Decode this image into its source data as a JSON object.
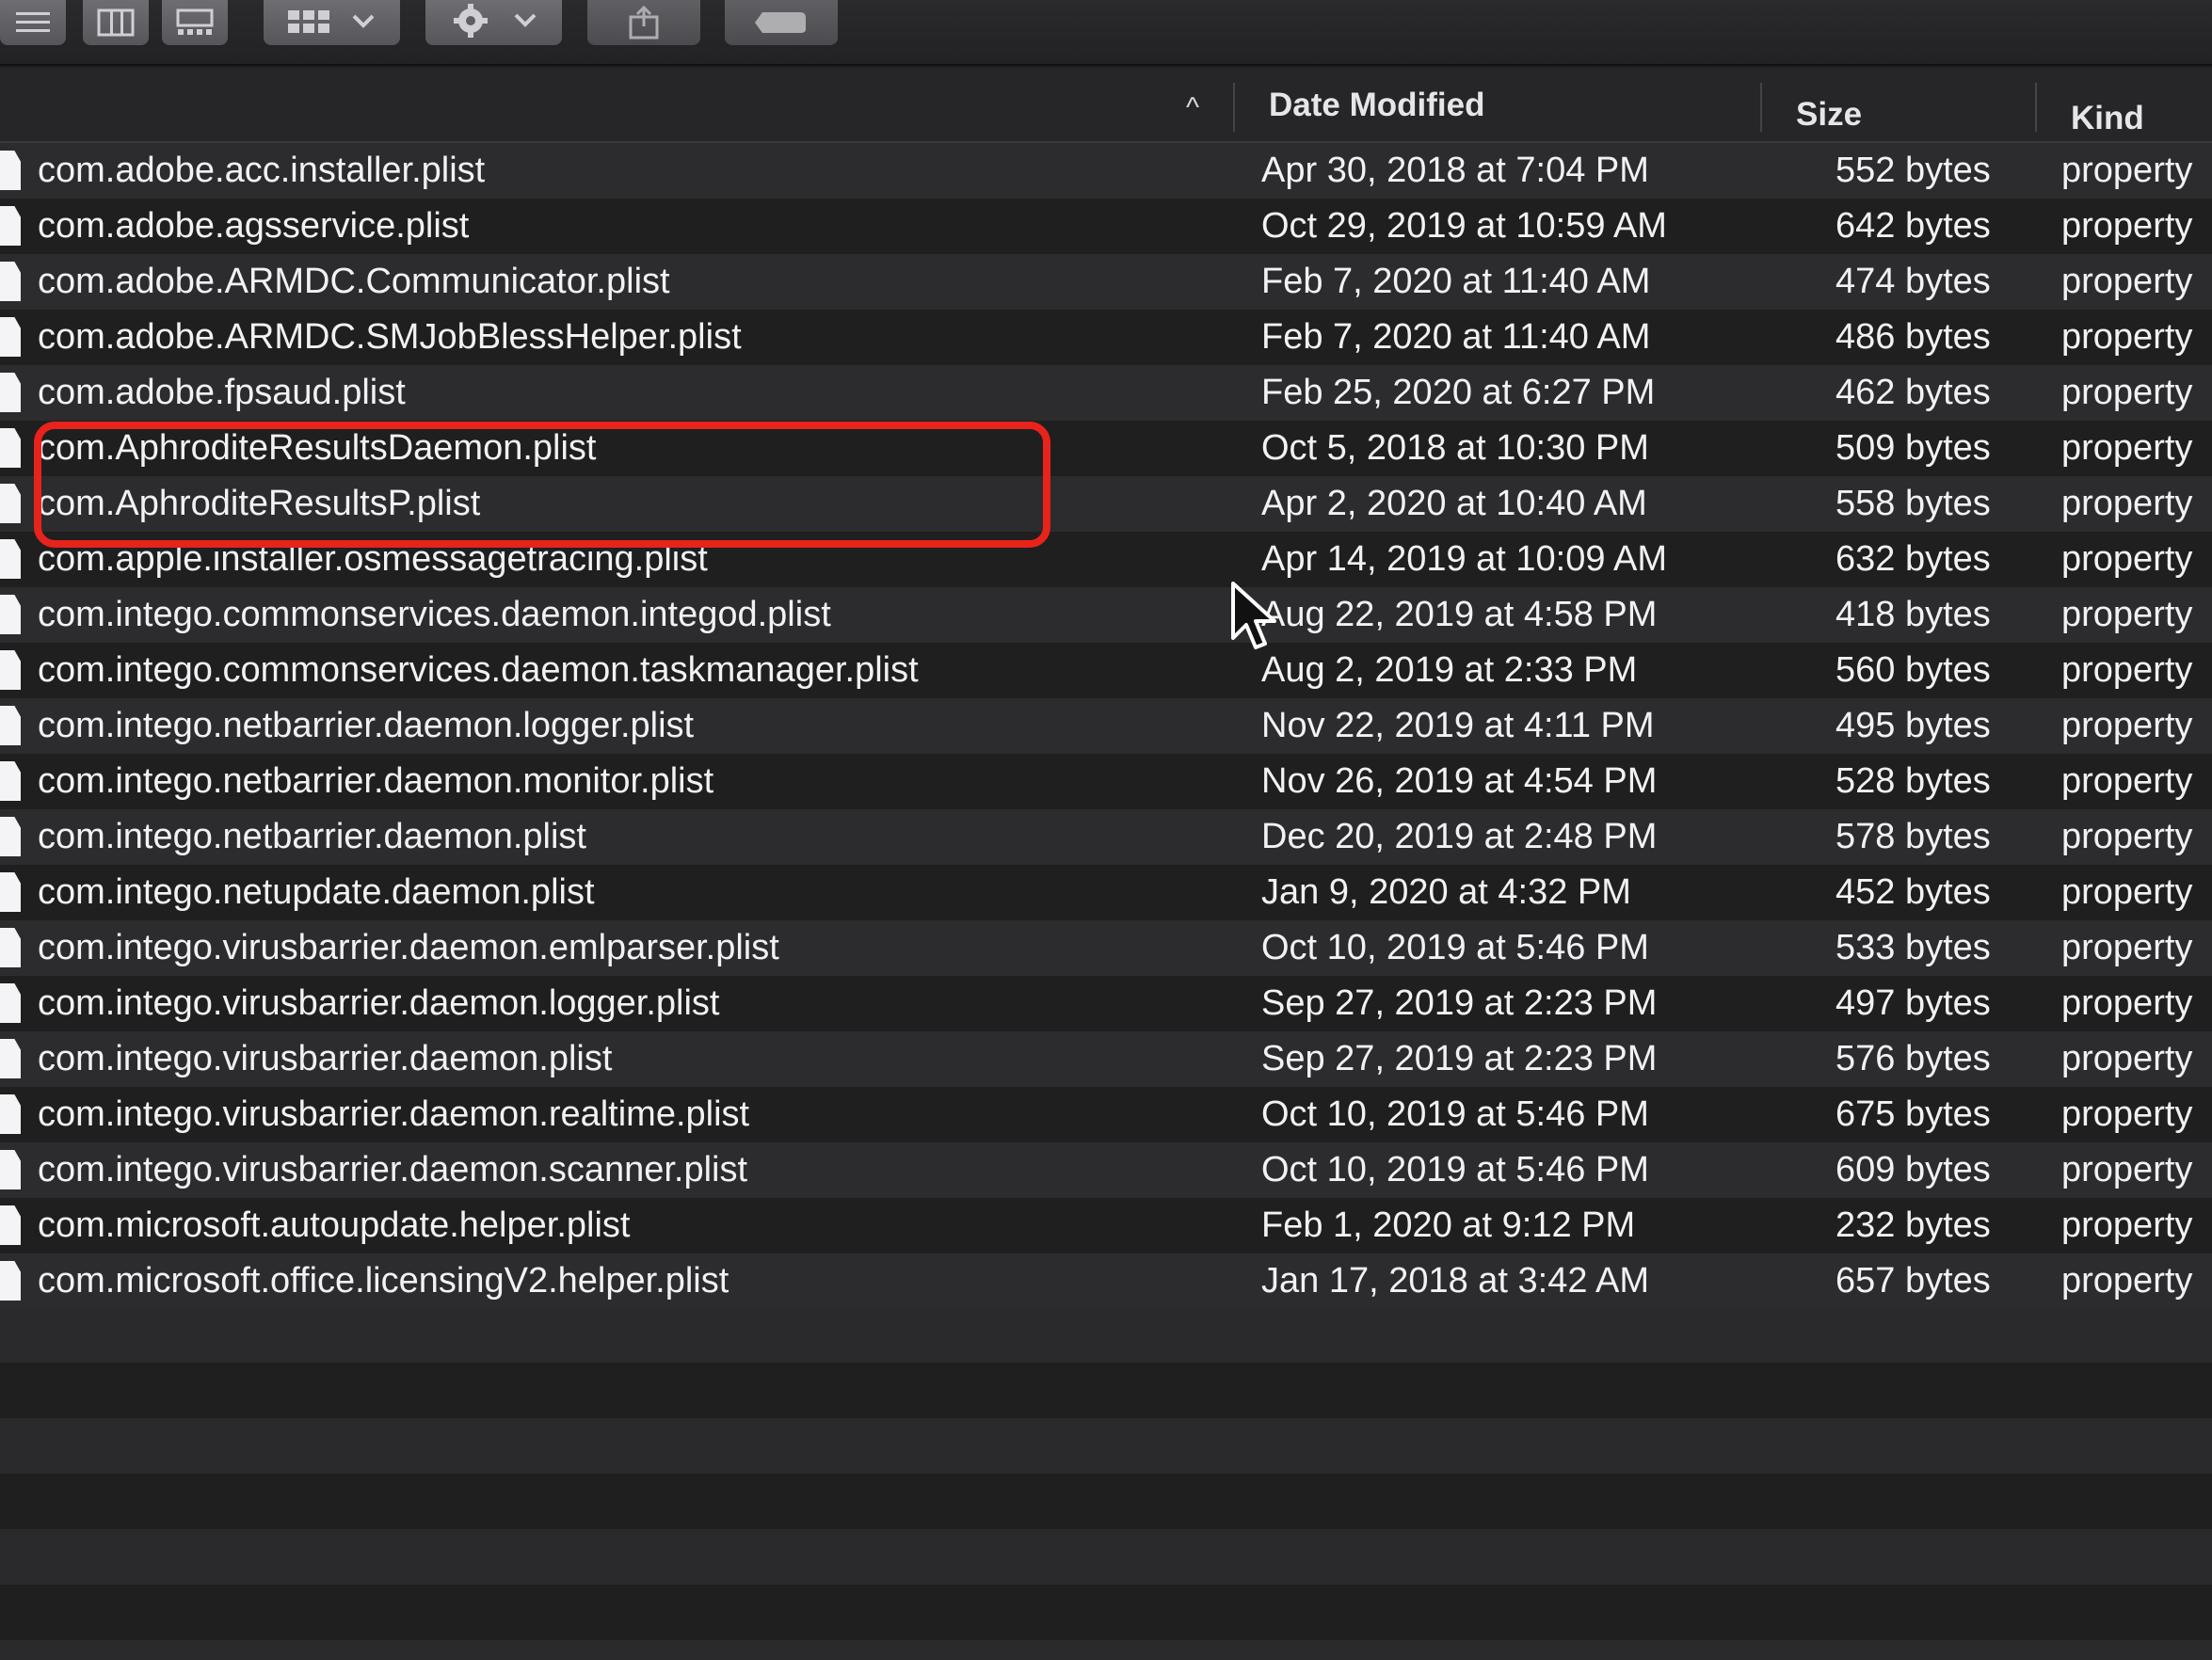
{
  "toolbar": {
    "buttons": [
      {
        "icon": "list-view-icon"
      },
      {
        "icon": "column-view-icon"
      },
      {
        "icon": "gallery-view-icon"
      },
      {
        "icon": "group-icon"
      },
      {
        "icon": "action-gear-icon"
      },
      {
        "icon": "share-icon"
      },
      {
        "icon": "tag-icon"
      }
    ]
  },
  "header": {
    "name_sort_indicator": "^",
    "date_modified": "Date Modified",
    "size": "Size",
    "kind": "Kind"
  },
  "files": [
    {
      "name": "com.adobe.acc.installer.plist",
      "date": "Apr 30, 2018 at 7:04 PM",
      "size": "552 bytes",
      "kind": "property"
    },
    {
      "name": "com.adobe.agsservice.plist",
      "date": "Oct 29, 2019 at 10:59 AM",
      "size": "642 bytes",
      "kind": "property"
    },
    {
      "name": "com.adobe.ARMDC.Communicator.plist",
      "date": "Feb 7, 2020 at 11:40 AM",
      "size": "474 bytes",
      "kind": "property"
    },
    {
      "name": "com.adobe.ARMDC.SMJobBlessHelper.plist",
      "date": "Feb 7, 2020 at 11:40 AM",
      "size": "486 bytes",
      "kind": "property"
    },
    {
      "name": "com.adobe.fpsaud.plist",
      "date": "Feb 25, 2020 at 6:27 PM",
      "size": "462 bytes",
      "kind": "property"
    },
    {
      "name": "com.AphroditeResultsDaemon.plist",
      "date": "Oct 5, 2018 at 10:30 PM",
      "size": "509 bytes",
      "kind": "property"
    },
    {
      "name": "com.AphroditeResultsP.plist",
      "date": "Apr 2, 2020 at 10:40 AM",
      "size": "558 bytes",
      "kind": "property"
    },
    {
      "name": "com.apple.installer.osmessagetracing.plist",
      "date": "Apr 14, 2019 at 10:09 AM",
      "size": "632 bytes",
      "kind": "property"
    },
    {
      "name": "com.intego.commonservices.daemon.integod.plist",
      "date": "Aug 22, 2019 at 4:58 PM",
      "size": "418 bytes",
      "kind": "property"
    },
    {
      "name": "com.intego.commonservices.daemon.taskmanager.plist",
      "date": "Aug 2, 2019 at 2:33 PM",
      "size": "560 bytes",
      "kind": "property"
    },
    {
      "name": "com.intego.netbarrier.daemon.logger.plist",
      "date": "Nov 22, 2019 at 4:11 PM",
      "size": "495 bytes",
      "kind": "property"
    },
    {
      "name": "com.intego.netbarrier.daemon.monitor.plist",
      "date": "Nov 26, 2019 at 4:54 PM",
      "size": "528 bytes",
      "kind": "property"
    },
    {
      "name": "com.intego.netbarrier.daemon.plist",
      "date": "Dec 20, 2019 at 2:48 PM",
      "size": "578 bytes",
      "kind": "property"
    },
    {
      "name": "com.intego.netupdate.daemon.plist",
      "date": "Jan 9, 2020 at 4:32 PM",
      "size": "452 bytes",
      "kind": "property"
    },
    {
      "name": "com.intego.virusbarrier.daemon.emlparser.plist",
      "date": "Oct 10, 2019 at 5:46 PM",
      "size": "533 bytes",
      "kind": "property"
    },
    {
      "name": "com.intego.virusbarrier.daemon.logger.plist",
      "date": "Sep 27, 2019 at 2:23 PM",
      "size": "497 bytes",
      "kind": "property"
    },
    {
      "name": "com.intego.virusbarrier.daemon.plist",
      "date": "Sep 27, 2019 at 2:23 PM",
      "size": "576 bytes",
      "kind": "property"
    },
    {
      "name": "com.intego.virusbarrier.daemon.realtime.plist",
      "date": "Oct 10, 2019 at 5:46 PM",
      "size": "675 bytes",
      "kind": "property"
    },
    {
      "name": "com.intego.virusbarrier.daemon.scanner.plist",
      "date": "Oct 10, 2019 at 5:46 PM",
      "size": "609 bytes",
      "kind": "property"
    },
    {
      "name": "com.microsoft.autoupdate.helper.plist",
      "date": "Feb 1, 2020 at 9:12 PM",
      "size": "232 bytes",
      "kind": "property"
    },
    {
      "name": "com.microsoft.office.licensingV2.helper.plist",
      "date": "Jan 17, 2018 at 3:42 AM",
      "size": "657 bytes",
      "kind": "property"
    }
  ],
  "highlight": {
    "color": "#e8231b",
    "rows": [
      5,
      6
    ]
  },
  "colors": {
    "background": "#1f1f20",
    "row_alt": "#2c2c2e",
    "text": "#f2f2f4"
  }
}
